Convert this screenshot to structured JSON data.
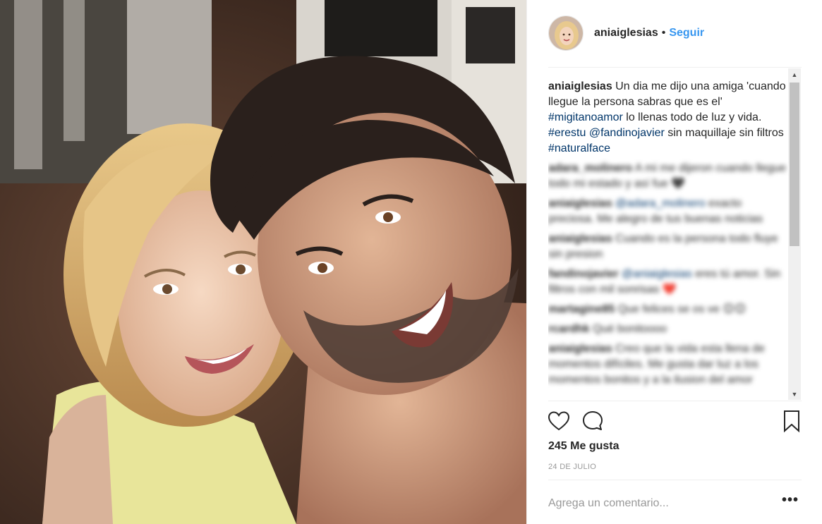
{
  "header": {
    "username": "aniaiglesias",
    "separator": "•",
    "follow_label": "Seguir"
  },
  "caption": {
    "username": "aniaiglesias",
    "text_1": "Un dia me dijo una amiga 'cuando llegue la persona sabras que es el'",
    "hashtag_1": "#migitanoamor",
    "text_2": "lo llenas todo de luz y vida.",
    "hashtag_2": "#erestu",
    "mention_1": "@fandinojavier",
    "text_3": "sin maquillaje sin filtros",
    "hashtag_3": "#naturalface"
  },
  "comments": [
    {
      "username": "adara_molinero",
      "text": "A mi me dijeron cuando llegue todo mi estado y así fue 🖤"
    },
    {
      "username": "aniaiglesias",
      "mention": "@adara_molinero",
      "text": "exacto preciosa. Me alegro de tus buenas noticias"
    },
    {
      "username": "aniaiglesias",
      "text": "Cuando es la persona todo fluye sin presion"
    },
    {
      "username": "fandinojavier",
      "mention": "@aniaiglesias",
      "text": "eres tú amor. Sin filtros con mil sonrisas ❤️"
    },
    {
      "username": "martagine85",
      "text": "Que felices se os ve 😊😊"
    },
    {
      "username": "rcardhk",
      "text": "Qué bonitoooo"
    },
    {
      "username": "aniaiglesias",
      "text": "Creo que la vida esta llena de momentos difíciles. Me gusta dar luz a los momentos bonitos y a la ilusion del amor"
    }
  ],
  "scrollbar": {
    "up_arrow": "▲",
    "down_arrow": "▼"
  },
  "actions": {
    "like_icon": "heart-outline",
    "comment_icon": "speech-bubble",
    "save_icon": "bookmark-outline"
  },
  "likes_label": "245 Me gusta",
  "date_label": "24 DE JULIO",
  "add_comment": {
    "placeholder": "Agrega un comentario...",
    "more_label": "•••"
  },
  "colors": {
    "link_blue": "#3897f0",
    "hashtag": "#003569",
    "text": "#262626",
    "muted": "#999999"
  }
}
